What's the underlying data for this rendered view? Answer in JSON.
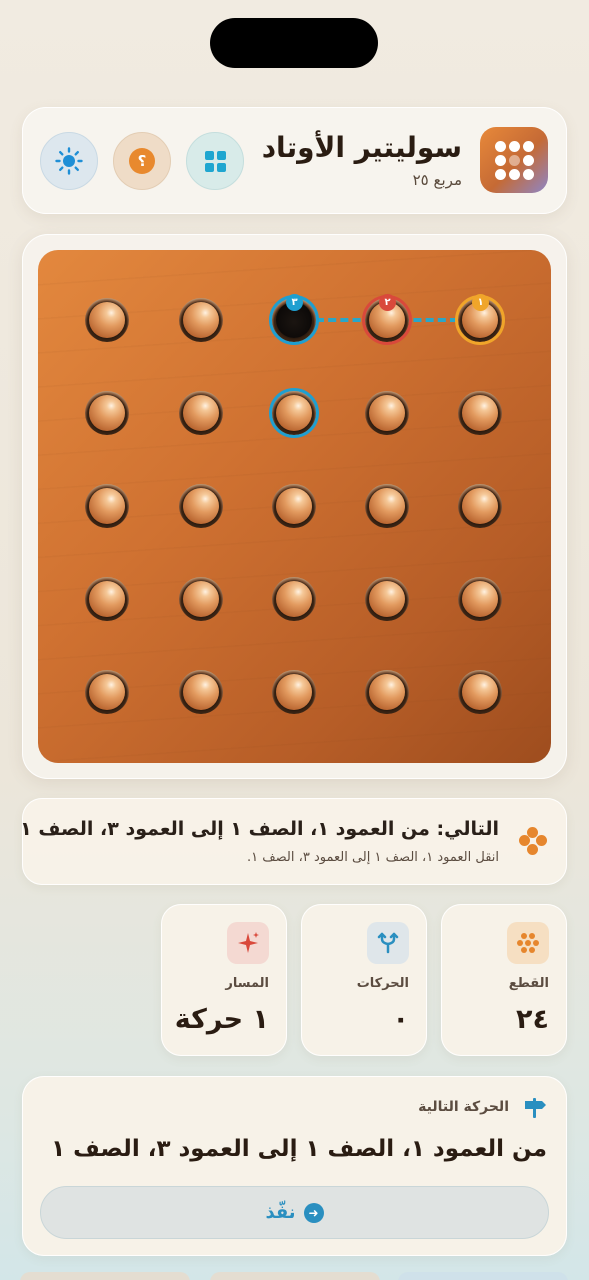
{
  "header": {
    "title": "سوليتير الأوتاد",
    "subtitle": "مربع ٢٥",
    "buttons": [
      "grid-icon",
      "help-icon",
      "sun-icon"
    ],
    "help_glyph": "؟"
  },
  "board": {
    "rows": 5,
    "cols": 5,
    "pegs": [
      [
        1,
        1,
        0,
        1,
        1
      ],
      [
        1,
        1,
        1,
        1,
        1
      ],
      [
        1,
        1,
        1,
        1,
        1
      ],
      [
        1,
        1,
        1,
        1,
        1
      ],
      [
        1,
        1,
        1,
        1,
        1
      ]
    ],
    "path_markers": [
      {
        "label": "٣",
        "color": "#1f9fd0"
      },
      {
        "label": "٢",
        "color": "#d9493b"
      },
      {
        "label": "١",
        "color": "#f0a52a"
      }
    ],
    "selected_color": "#1f9fd0"
  },
  "hint": {
    "title": "التالي: من العمود ١، الصف ١ إلى العمود ٣، الصف ١",
    "subtitle": "انقل العمود ١، الصف ١ إلى العمود ٣، الصف ١."
  },
  "stats": [
    {
      "label": "القطع",
      "value": "٢٤",
      "icon": "dots-icon"
    },
    {
      "label": "الحركات",
      "value": "٠",
      "icon": "branch-icon"
    },
    {
      "label": "المسار",
      "value": "١ حركة",
      "icon": "sparkle-icon"
    }
  ],
  "next_move": {
    "label": "الحركة التالية",
    "move": "من العمود ١، الصف ١ إلى العمود ٣، الصف ١",
    "execute_label": "نفّذ"
  },
  "colors": {
    "accent": "#2a8fc0",
    "orange": "#e6862d",
    "board": "#cf7131"
  }
}
